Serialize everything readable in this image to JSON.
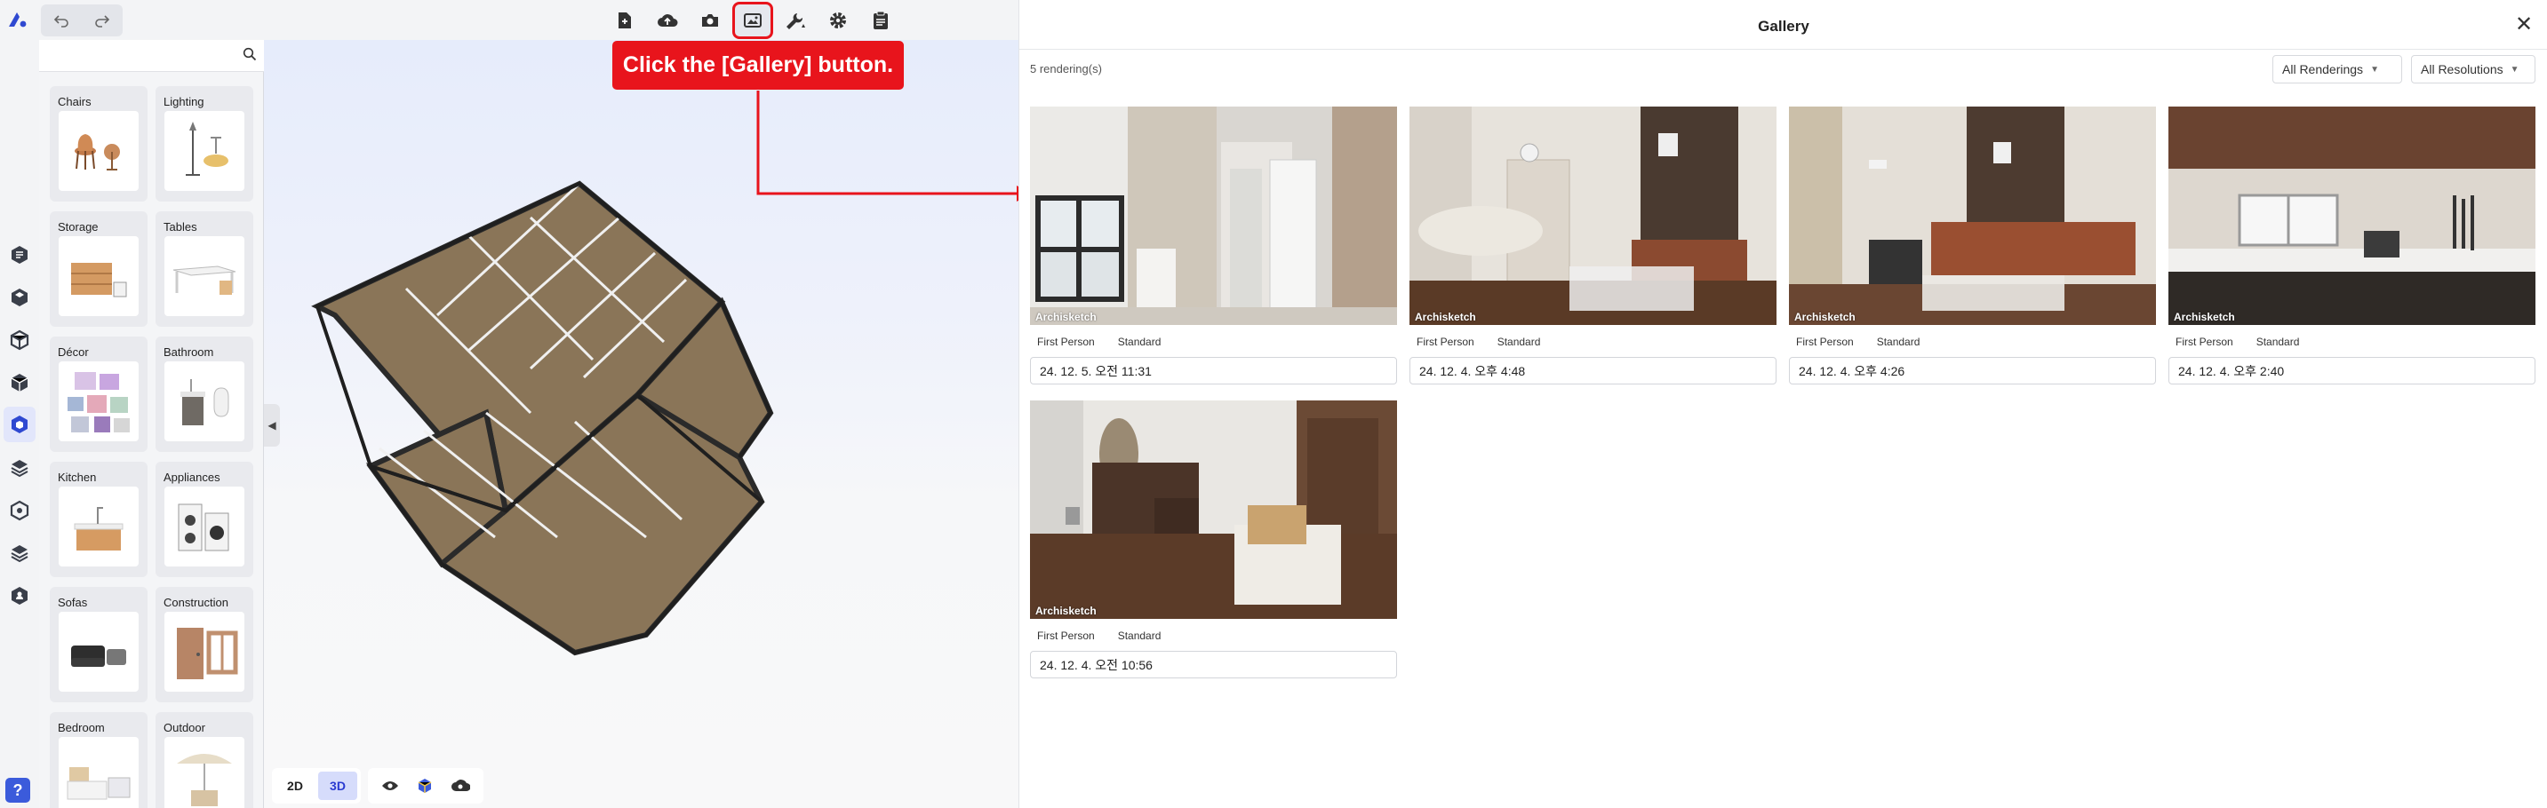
{
  "toolbar": {
    "icons": [
      "new-file-icon",
      "cloud-upload-icon",
      "camera-icon",
      "gallery-icon",
      "wrench-icon",
      "gear-icon",
      "clipboard-icon"
    ]
  },
  "catalog": {
    "search_placeholder": "",
    "categories": [
      {
        "label": "Chairs"
      },
      {
        "label": "Lighting"
      },
      {
        "label": "Storage"
      },
      {
        "label": "Tables"
      },
      {
        "label": "Décor"
      },
      {
        "label": "Bathroom"
      },
      {
        "label": "Kitchen"
      },
      {
        "label": "Appliances"
      },
      {
        "label": "Sofas"
      },
      {
        "label": "Construction"
      },
      {
        "label": "Bedroom"
      },
      {
        "label": "Outdoor"
      }
    ]
  },
  "viewport": {
    "view_2d": "2D",
    "view_3d": "3D",
    "active_view": "3D"
  },
  "callout": {
    "text": "Click the [Gallery] button."
  },
  "rail": {
    "help_label": "?"
  },
  "gallery": {
    "title": "Gallery",
    "count": "5 rendering(s)",
    "filter_renderings": "All Renderings",
    "filter_resolutions": "All Resolutions",
    "close_label": "✕",
    "watermark": "Archisketch",
    "items": [
      {
        "camera": "First Person",
        "quality": "Standard",
        "date": "24. 12. 5. 오전 11:31"
      },
      {
        "camera": "First Person",
        "quality": "Standard",
        "date": "24. 12. 4. 오후 4:48"
      },
      {
        "camera": "First Person",
        "quality": "Standard",
        "date": "24. 12. 4. 오후 4:26"
      },
      {
        "camera": "First Person",
        "quality": "Standard",
        "date": "24. 12. 4. 오후 2:40"
      },
      {
        "camera": "First Person",
        "quality": "Standard",
        "date": "24. 12. 4. 오전 10:56"
      }
    ]
  },
  "colors": {
    "accent": "#3b5bdb",
    "callout_red": "#e8141c",
    "floor": "#8a7558"
  }
}
